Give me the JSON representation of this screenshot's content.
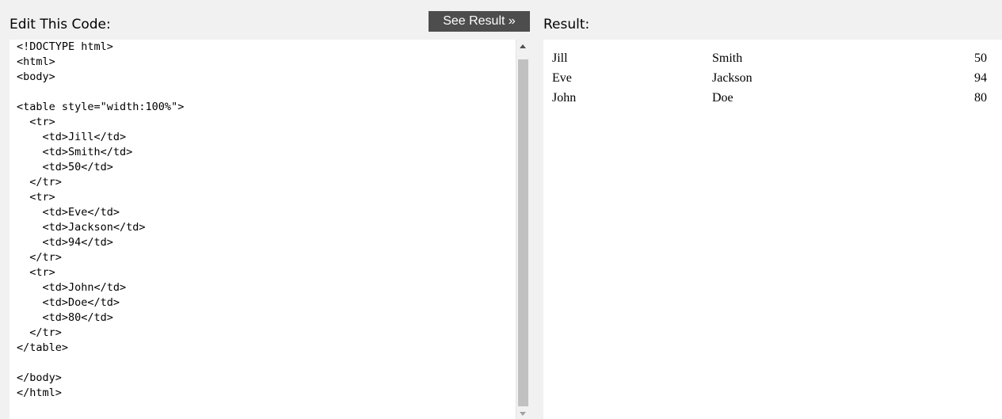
{
  "editor": {
    "label": "Edit This Code:",
    "see_result_label": "See Result »",
    "code": "<!DOCTYPE html>\n<html>\n<body>\n\n<table style=\"width:100%\">\n  <tr>\n    <td>Jill</td>\n    <td>Smith</td>\n    <td>50</td>\n  </tr>\n  <tr>\n    <td>Eve</td>\n    <td>Jackson</td>\n    <td>94</td>\n  </tr>\n  <tr>\n    <td>John</td>\n    <td>Doe</td>\n    <td>80</td>\n  </tr>\n</table>\n\n</body>\n</html>"
  },
  "result": {
    "label": "Result:",
    "rows": [
      [
        "Jill",
        "Smith",
        "50"
      ],
      [
        "Eve",
        "Jackson",
        "94"
      ],
      [
        "John",
        "Doe",
        "80"
      ]
    ]
  }
}
